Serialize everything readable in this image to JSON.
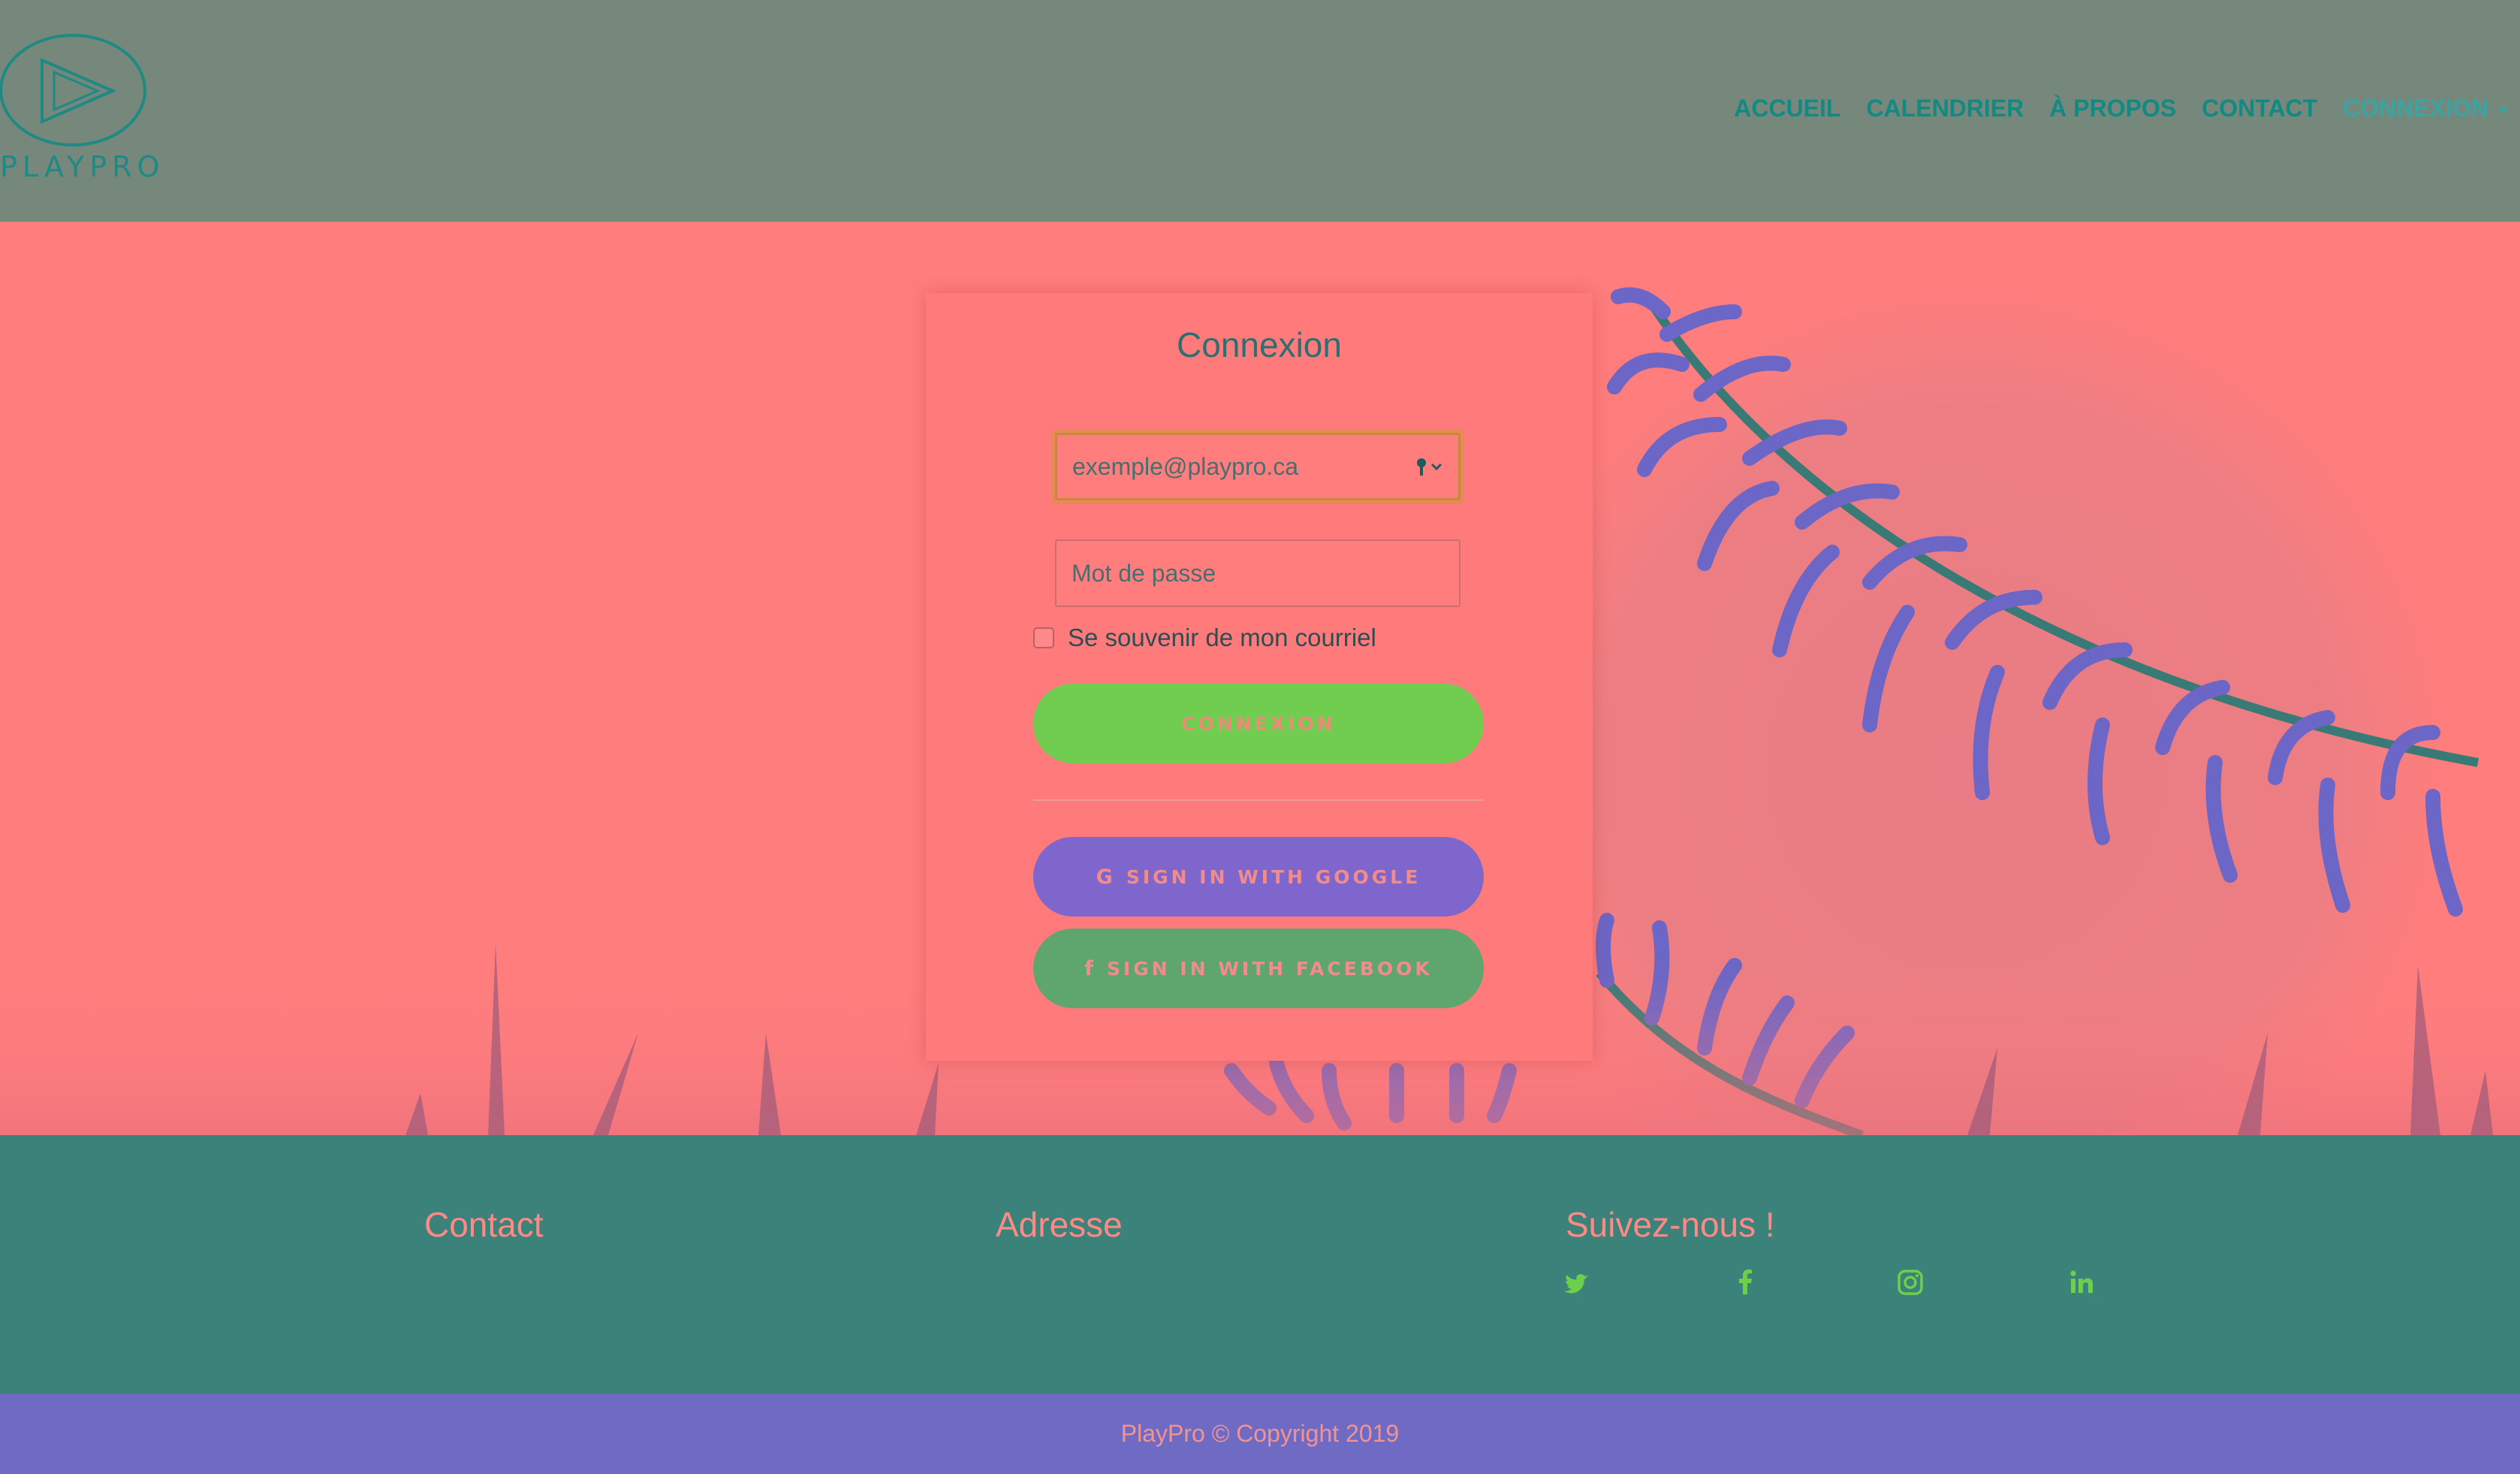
{
  "brand": {
    "name": "PLAYPRO"
  },
  "nav": {
    "items": [
      {
        "label": "ACCUEIL"
      },
      {
        "label": "CALENDRIER"
      },
      {
        "label": "À PROPOS"
      },
      {
        "label": "CONTACT"
      },
      {
        "label": "CONNEXION",
        "active": true,
        "dropdown": true
      }
    ]
  },
  "login": {
    "title": "Connexion",
    "email_placeholder": "exemple@playpro.ca",
    "email_value": "",
    "password_placeholder": "Mot de passe",
    "password_value": "",
    "remember_label": "Se souvenir de mon courriel",
    "remember_checked": false,
    "submit_label": "CONNEXION",
    "google_label": "SIGN IN WITH GOOGLE",
    "facebook_label": "SIGN IN WITH FACEBOOK"
  },
  "footer": {
    "contact_heading": "Contact",
    "address_heading": "Adresse",
    "social_heading": "Suivez-nous !",
    "social_icons": [
      "twitter-icon",
      "facebook-icon",
      "instagram-icon",
      "linkedin-icon"
    ],
    "copyright": "PlayPro © Copyright 2019"
  },
  "colors": {
    "header_bg": "#76877b",
    "hero_bg": "#ff7d7d",
    "nav_text": "#128a84",
    "login_button": "#70cd50",
    "google_button": "#7f66cc",
    "facebook_button": "#5ea56e",
    "footer_bg": "#3b827b",
    "copyright_bg": "#6f6bc4",
    "social_icon": "#6dd04a"
  }
}
